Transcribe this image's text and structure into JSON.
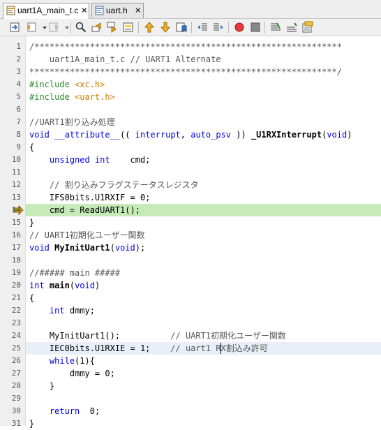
{
  "tabs": [
    {
      "label": "uart1A_main_t.c",
      "active": true,
      "close": "×"
    },
    {
      "label": "uart.h",
      "active": false,
      "close": "×"
    }
  ],
  "toolbar_icons": [
    "last-edit-icon",
    "back-icon",
    "dropdown-icon",
    "forward-icon",
    "dropdown-icon",
    "find-icon",
    "find-previous-icon",
    "find-next-icon",
    "toggle-highlight-icon",
    "previous-bookmark-icon",
    "next-bookmark-icon",
    "toggle-bookmark-icon",
    "shift-left-icon",
    "shift-right-icon",
    "start-macro-icon",
    "stop-macro-icon",
    "comment-icon",
    "uncomment-icon",
    "error-stripe-icon"
  ],
  "editor": {
    "program_counter_line": 14,
    "current_line": 25,
    "lines": [
      {
        "n": "1",
        "tokens": [
          {
            "t": "/*************************************************************",
            "c": "cm"
          }
        ]
      },
      {
        "n": "2",
        "tokens": [
          {
            "t": "    uart1A_main_t.c // UART1 Alternate",
            "c": "cm"
          }
        ]
      },
      {
        "n": "3",
        "tokens": [
          {
            "t": "*************************************************************/",
            "c": "cm"
          }
        ]
      },
      {
        "n": "4",
        "tokens": [
          {
            "t": "#include ",
            "c": "pp"
          },
          {
            "t": "<xc.h>",
            "c": "inc"
          }
        ]
      },
      {
        "n": "5",
        "tokens": [
          {
            "t": "#include ",
            "c": "pp"
          },
          {
            "t": "<uart.h>",
            "c": "inc"
          }
        ]
      },
      {
        "n": "6",
        "tokens": []
      },
      {
        "n": "7",
        "tokens": [
          {
            "t": "//UART1割り込み処理",
            "c": "cm"
          }
        ]
      },
      {
        "n": "8",
        "tokens": [
          {
            "t": "void",
            "c": "kw"
          },
          {
            "t": " "
          },
          {
            "t": "__attribute__",
            "c": "kw"
          },
          {
            "t": "(( "
          },
          {
            "t": "interrupt",
            "c": "kw"
          },
          {
            "t": ", "
          },
          {
            "t": "auto_psv",
            "c": "kw"
          },
          {
            "t": " )) "
          },
          {
            "t": "_U1RXInterrupt",
            "c": "b"
          },
          {
            "t": "("
          },
          {
            "t": "void",
            "c": "kw"
          },
          {
            "t": ")"
          }
        ]
      },
      {
        "n": "9",
        "tokens": [
          {
            "t": "{"
          }
        ]
      },
      {
        "n": "10",
        "tokens": [
          {
            "t": "    "
          },
          {
            "t": "unsigned int",
            "c": "kw"
          },
          {
            "t": "    cmd;"
          }
        ]
      },
      {
        "n": "11",
        "tokens": []
      },
      {
        "n": "12",
        "tokens": [
          {
            "t": "    // 割り込みフラグステータスレジスタ",
            "c": "cm"
          }
        ]
      },
      {
        "n": "13",
        "tokens": [
          {
            "t": "    IFS0bits.U1RXIF = 0;"
          }
        ]
      },
      {
        "n": "14",
        "tokens": [
          {
            "t": "    cmd = ReadUART1();"
          }
        ]
      },
      {
        "n": "15",
        "tokens": [
          {
            "t": "}"
          }
        ]
      },
      {
        "n": "16",
        "tokens": [
          {
            "t": "// UART1初期化ユーザー関数",
            "c": "cm"
          }
        ]
      },
      {
        "n": "17",
        "tokens": [
          {
            "t": "void",
            "c": "kw"
          },
          {
            "t": " "
          },
          {
            "t": "MyInitUart1",
            "c": "b"
          },
          {
            "t": "("
          },
          {
            "t": "void",
            "c": "kw"
          },
          {
            "t": ");"
          }
        ]
      },
      {
        "n": "18",
        "tokens": []
      },
      {
        "n": "19",
        "tokens": [
          {
            "t": "//##### main #####",
            "c": "cm"
          }
        ]
      },
      {
        "n": "20",
        "tokens": [
          {
            "t": "int",
            "c": "kw"
          },
          {
            "t": " "
          },
          {
            "t": "main",
            "c": "b"
          },
          {
            "t": "("
          },
          {
            "t": "void",
            "c": "kw"
          },
          {
            "t": ")"
          }
        ]
      },
      {
        "n": "21",
        "tokens": [
          {
            "t": "{"
          }
        ]
      },
      {
        "n": "22",
        "tokens": [
          {
            "t": "    "
          },
          {
            "t": "int",
            "c": "kw"
          },
          {
            "t": " dmmy;"
          }
        ]
      },
      {
        "n": "23",
        "tokens": []
      },
      {
        "n": "24",
        "tokens": [
          {
            "t": "    MyInitUart1();          "
          },
          {
            "t": "// UART1初期化ユーザー関数",
            "c": "cm"
          }
        ]
      },
      {
        "n": "25",
        "tokens": [
          {
            "t": "    IEC0bits.U1RXIE = 1;    "
          },
          {
            "t": "// uart1 RX割込み許可",
            "c": "cm"
          }
        ]
      },
      {
        "n": "26",
        "tokens": [
          {
            "t": "    "
          },
          {
            "t": "while",
            "c": "kw"
          },
          {
            "t": "(1){"
          }
        ]
      },
      {
        "n": "27",
        "tokens": [
          {
            "t": "        dmmy = 0;"
          }
        ]
      },
      {
        "n": "28",
        "tokens": [
          {
            "t": "    }"
          }
        ]
      },
      {
        "n": "29",
        "tokens": []
      },
      {
        "n": "30",
        "tokens": [
          {
            "t": "    "
          },
          {
            "t": "return",
            "c": "kw"
          },
          {
            "t": "  0;"
          }
        ]
      },
      {
        "n": "31",
        "tokens": [
          {
            "t": "}"
          }
        ]
      }
    ]
  }
}
